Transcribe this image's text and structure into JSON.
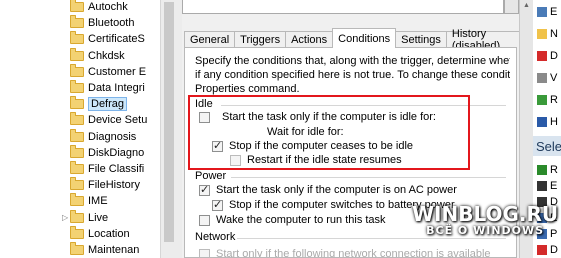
{
  "tree": {
    "items": [
      {
        "label": "Autochk",
        "selected": false,
        "expander": false
      },
      {
        "label": "Bluetooth",
        "selected": false,
        "expander": false
      },
      {
        "label": "CertificateS",
        "selected": false,
        "expander": false
      },
      {
        "label": "Chkdsk",
        "selected": false,
        "expander": false
      },
      {
        "label": "Customer E",
        "selected": false,
        "expander": false
      },
      {
        "label": "Data Integri",
        "selected": false,
        "expander": false
      },
      {
        "label": "Defrag",
        "selected": true,
        "expander": false
      },
      {
        "label": "Device Setu",
        "selected": false,
        "expander": false
      },
      {
        "label": "Diagnosis",
        "selected": false,
        "expander": false
      },
      {
        "label": "DiskDiagno",
        "selected": false,
        "expander": false
      },
      {
        "label": "File Classifi",
        "selected": false,
        "expander": false
      },
      {
        "label": "FileHistory",
        "selected": false,
        "expander": false
      },
      {
        "label": "IME",
        "selected": false,
        "expander": false
      },
      {
        "label": "Live",
        "selected": false,
        "expander": true
      },
      {
        "label": "Location",
        "selected": false,
        "expander": false
      },
      {
        "label": "Maintenan",
        "selected": false,
        "expander": false
      }
    ],
    "expander_glyph": "▷"
  },
  "dialog": {
    "tabs": [
      {
        "label": "General",
        "active": false
      },
      {
        "label": "Triggers",
        "active": false
      },
      {
        "label": "Actions",
        "active": false
      },
      {
        "label": "Conditions",
        "active": true
      },
      {
        "label": "Settings",
        "active": false
      },
      {
        "label": "History (disabled)",
        "active": false
      }
    ],
    "description": [
      "Specify the conditions that, along with the trigger, determine whethe",
      "if any condition specified here is not true.  To change these conditio",
      "Properties command."
    ],
    "idle": {
      "group_label": "Idle",
      "start_only_if_idle": {
        "label": "Start the task only if the computer is idle for:",
        "checked": false
      },
      "wait_for_idle_label": "Wait for idle for:",
      "stop_if_not_idle": {
        "label": "Stop if the computer ceases to be idle",
        "checked": true
      },
      "restart_if_idle_resumes": {
        "label": "Restart if the idle state resumes",
        "checked": false
      }
    },
    "power": {
      "group_label": "Power",
      "start_only_on_ac": {
        "label": "Start the task only if the computer is on AC power",
        "checked": true
      },
      "stop_if_battery": {
        "label": "Stop if the computer switches to battery power",
        "checked": true
      },
      "wake_to_run": {
        "label": "Wake the computer to run this task",
        "checked": false
      }
    },
    "network": {
      "group_label": "Network",
      "partial_label": "Start only if the following network connection is available"
    }
  },
  "actions_pane": {
    "items": [
      {
        "label": "E",
        "icon_color": "#4a7bb7"
      },
      {
        "label": "N",
        "icon_color": "#f0c24a"
      },
      {
        "label": "D",
        "icon_color": "#d42a2a"
      },
      {
        "label": "V",
        "icon_color": "#8a8a8a"
      },
      {
        "label": "R",
        "icon_color": "#3a9a3a"
      },
      {
        "label": "H",
        "icon_color": "#2a5aa8"
      }
    ],
    "selected_header": "Sele",
    "selected_items": [
      {
        "label": "R",
        "icon_color": "#2a8a2a"
      },
      {
        "label": "E",
        "icon_color": "#333333"
      },
      {
        "label": "D",
        "icon_color": "#333333"
      },
      {
        "label": "E",
        "icon_color": "#3a6ab0"
      },
      {
        "label": "P",
        "icon_color": "#3a6ab0"
      },
      {
        "label": "D",
        "icon_color": "#d42a2a"
      }
    ]
  },
  "watermark": {
    "line1": "WINBLOG.RU",
    "line2": "ВСЁ О WINDOWS"
  },
  "colors": {
    "highlight_border": "#e3171c",
    "folder": "#f3d273"
  }
}
